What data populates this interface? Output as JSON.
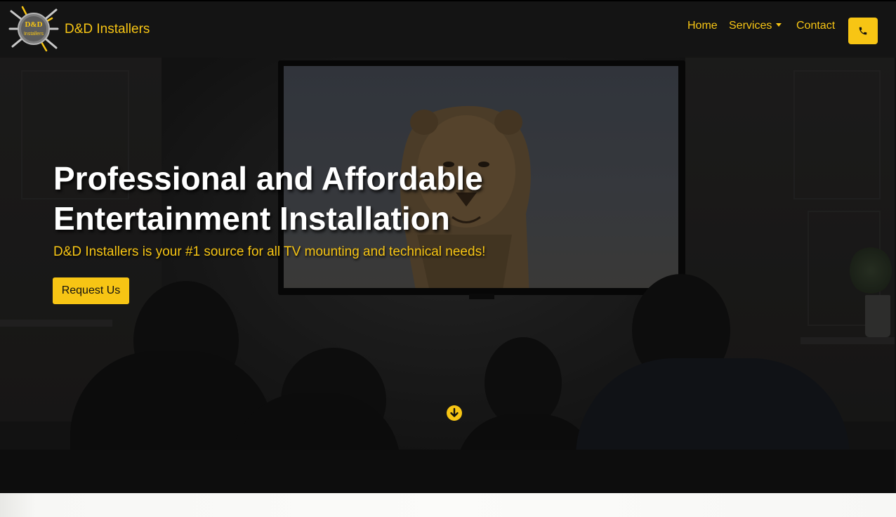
{
  "navbar": {
    "brand_name": "D&D Installers",
    "logo_text_top": "D&D",
    "logo_text_bottom": "Installers",
    "links": [
      {
        "label": "Home"
      },
      {
        "label": "Services",
        "has_dropdown": true
      },
      {
        "label": "Contact"
      }
    ],
    "phone_icon": "phone-icon"
  },
  "hero": {
    "title": "Professional and Affordable Entertainment Installation",
    "subtitle": "D&D Installers is your #1 source for all TV mounting and technical needs!",
    "cta_label": "Request Us",
    "scroll_icon": "arrow-down-circle-icon"
  },
  "colors": {
    "accent": "#f7c514",
    "navbar_bg": "#141414",
    "title_text": "#ffffff"
  }
}
